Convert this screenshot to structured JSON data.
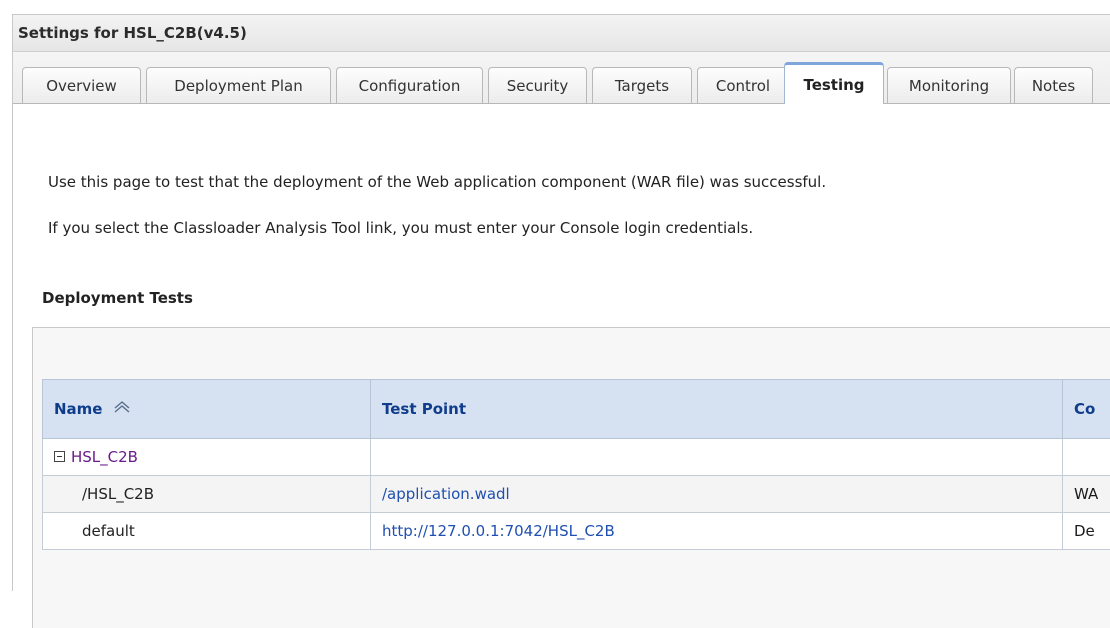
{
  "window": {
    "title": "Settings for HSL_C2B(v4.5)"
  },
  "tabs": [
    {
      "label": "Overview",
      "active": false
    },
    {
      "label": "Deployment Plan",
      "active": false
    },
    {
      "label": "Configuration",
      "active": false
    },
    {
      "label": "Security",
      "active": false
    },
    {
      "label": "Targets",
      "active": false
    },
    {
      "label": "Control",
      "active": false
    },
    {
      "label": "Testing",
      "active": true
    },
    {
      "label": "Monitoring",
      "active": false
    },
    {
      "label": "Notes",
      "active": false
    }
  ],
  "content": {
    "intro_1": "Use this page to test that the deployment of the Web application component (WAR file) was successful.",
    "intro_2": "If you select the Classloader Analysis Tool link, you must enter your Console login credentials.",
    "section_title": "Deployment Tests"
  },
  "table": {
    "columns": [
      {
        "label": "Name",
        "sort_icon": "sort-ascending-icon"
      },
      {
        "label": "Test Point"
      },
      {
        "label": "Co"
      }
    ],
    "parent_row": {
      "name": "HSL_C2B",
      "expander_icon": "collapse-icon"
    },
    "rows": [
      {
        "name": "/HSL_C2B",
        "test_point": "/application.wadl",
        "comment": "WA"
      },
      {
        "name": "default",
        "test_point": "http://127.0.0.1:7042/HSL_C2B",
        "comment": "De"
      }
    ]
  },
  "colors": {
    "header_bg": "#d6e2f1",
    "header_text": "#0f3d8c",
    "link": "#1f4fb0",
    "visited_link": "#6a1b8a",
    "active_tab_accent": "#7ea6da"
  }
}
